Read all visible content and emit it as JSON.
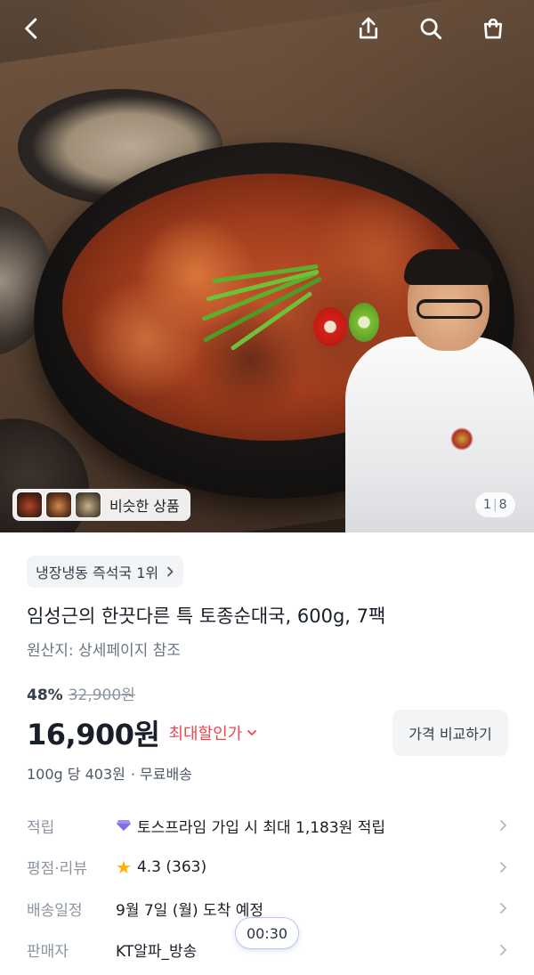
{
  "header": {
    "back_icon": "chevron-left-icon",
    "share_icon": "share-icon",
    "search_icon": "search-icon",
    "cart_icon": "shopping-bag-icon"
  },
  "hero": {
    "similar_label": "비슷한 상품",
    "pager_current": "1",
    "pager_total": "8"
  },
  "product": {
    "rank_label": "냉장냉동 즉석국 1위",
    "title": "임성근의 한끗다른 특 토종순대국, 600g, 7팩",
    "origin": "원산지: 상세페이지 참조",
    "discount_rate": "48%",
    "original_price": "32,900원",
    "price": "16,900원",
    "max_discount_label": "최대할인가",
    "compare_button": "가격 비교하기",
    "unit_price": "100g 당 403원",
    "shipping": "· 무료배송",
    "accent_color": "#f04452"
  },
  "info": {
    "points_label": "적립",
    "points_value": "토스프라임 가입 시 최대 1,183원 적립",
    "rating_label": "평점·리뷰",
    "rating_value": "4.3 (363)",
    "delivery_label": "배송일정",
    "delivery_value": "9월 7일 (월) 도착 예정",
    "seller_label": "판매자",
    "seller_value": "KT알파_방송"
  },
  "overlay": {
    "timer": "00:30"
  }
}
